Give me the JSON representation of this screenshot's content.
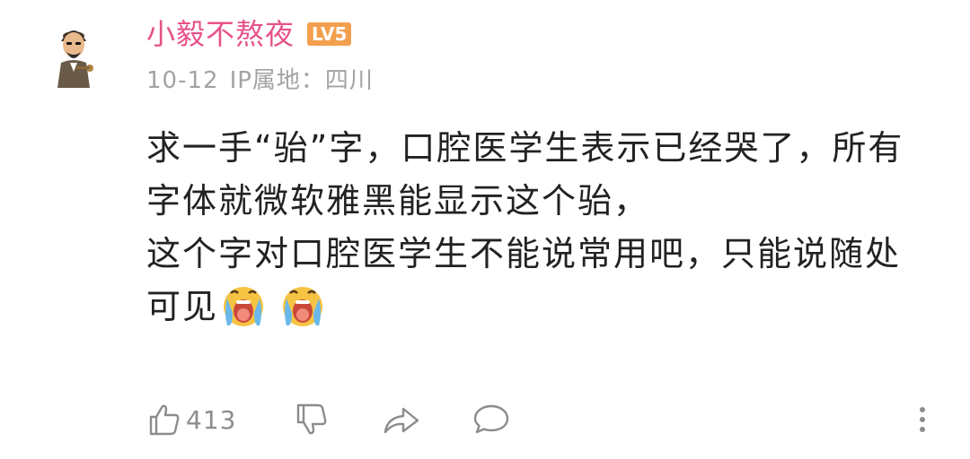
{
  "comment": {
    "username": "小毅不熬夜",
    "level_badge": "LV5",
    "date": "10-12",
    "location": "IP属地：四川",
    "lines": [
      "求一手“骀”字，口腔医学生表示已经哭了，所有",
      "字体就微软雅黑能显示这个骀，",
      "这个字对口腔医学生不能说常用吧，只能说随处",
      "可见"
    ],
    "emojis": [
      "crying-face-emoji",
      "crying-face-emoji"
    ],
    "like_count": "413"
  },
  "icons": {
    "like": "thumbs-up-icon",
    "dislike": "thumbs-down-icon",
    "share": "share-arrow-icon",
    "reply": "speech-bubble-icon",
    "more": "more-vertical-icon"
  },
  "colors": {
    "username": "#e7528a",
    "badge": "#f2a04e",
    "meta": "#a3a3a3",
    "body_text": "#222222",
    "icons": "#8c8c8c"
  }
}
